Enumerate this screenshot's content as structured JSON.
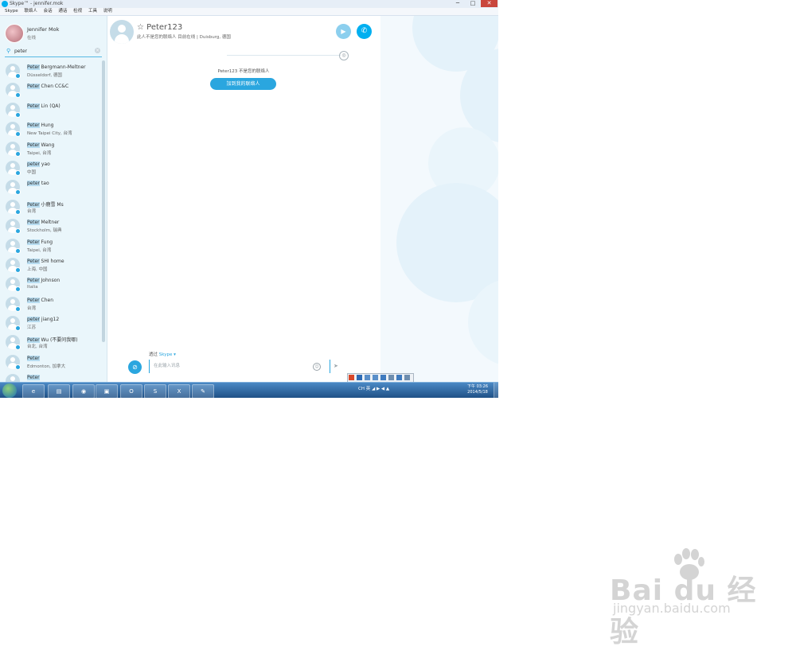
{
  "window": {
    "title": "Skype™ - jennifer.mok",
    "min_glyph": "─",
    "max_glyph": "□",
    "close_glyph": "✕"
  },
  "menu": [
    "Skype",
    "联络人",
    "会话",
    "通话",
    "检视",
    "工具",
    "说明"
  ],
  "profile": {
    "name": "Jennifer Mok",
    "status": "在线"
  },
  "search": {
    "value": "peter",
    "icon": "search-icon",
    "clear_glyph": "×"
  },
  "contacts": [
    {
      "match": "Peter",
      "rest": " Bergmann-Meltner",
      "location": "Düsseldorf, 德国"
    },
    {
      "match": "Peter",
      "rest": " Chen CC&C",
      "location": ""
    },
    {
      "match": "Peter",
      "rest": " Lin (QA)",
      "location": ""
    },
    {
      "match": "Peter",
      "rest": " Hung",
      "location": "New Taipei City, 台湾"
    },
    {
      "match": "Peter",
      "rest": " Wang",
      "location": "Taipei, 台湾"
    },
    {
      "match": "peter",
      "rest": " yao",
      "location": "中国"
    },
    {
      "match": "peter",
      "rest": " tao",
      "location": ""
    },
    {
      "match": "Peter",
      "rest": " 小鹿雪 Ms",
      "location": "台湾"
    },
    {
      "match": "Peter",
      "rest": " Meltner",
      "location": "Stockholm, 瑞典"
    },
    {
      "match": "Peter",
      "rest": " Fung",
      "location": "Taipei, 台湾"
    },
    {
      "match": "Peter",
      "rest": " SHI home",
      "location": "上海, 中国"
    },
    {
      "match": "Peter",
      "rest": " Johnson",
      "location": "Italia"
    },
    {
      "match": "Peter",
      "rest": " Chen",
      "location": "台湾"
    },
    {
      "match": "peter",
      "rest": " jiang12",
      "location": "江苏"
    },
    {
      "match": "Peter",
      "rest": " Wu (不要问我哪)",
      "location": "台北, 台湾"
    },
    {
      "match": "Peter",
      "rest": "",
      "location": "Edmonton, 加拿大"
    },
    {
      "match": "Peter",
      "rest": "",
      "location": ""
    }
  ],
  "chat": {
    "star_glyph": "☆",
    "contact_name": "Peter123",
    "sub_info": "此人不是您的联络人 目前在线 | Duisburg, 德国",
    "not_contact_msg": "Peter123 不是您的联络人",
    "add_contact_label": "加到我的联络人",
    "via_label": "透过",
    "via_link": "Skype ▾",
    "input_placeholder": "在此输入讯息",
    "video_glyph": "▶",
    "call_glyph": "✆",
    "attach_glyph": "⊘",
    "globe_glyph": "◎",
    "emoji_glyph": "☺",
    "send_glyph": "➤"
  },
  "taskbar": {
    "tray_text": "CH 英 ◢ ▶ ◀ ▲",
    "clock_time": "下午 03:26",
    "clock_date": "2014/5/18"
  },
  "watermark": {
    "main": "Bai du 经验",
    "url": "jingyan.baidu.com"
  },
  "colors": {
    "accent": "#00aff0",
    "button_blue": "#2aa6df",
    "sidebar_bg": "#eaf6fb",
    "highlight": "#b7dcf0",
    "taskbar": "#1d4e83"
  }
}
